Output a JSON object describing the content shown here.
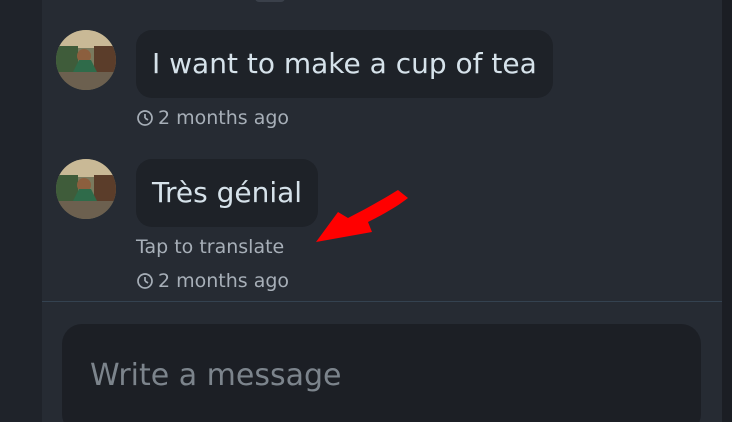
{
  "messages": [
    {
      "text": "I want to make a cup of tea",
      "timestamp": "2 months ago",
      "translate_label": ""
    },
    {
      "text": "Très génial",
      "timestamp": "2 months ago",
      "translate_label": "Tap to translate"
    }
  ],
  "composer": {
    "placeholder": "Write a message"
  },
  "icons": {
    "timestamp_icon": "clock-icon",
    "annotation": "red-arrow-icon"
  },
  "colors": {
    "background": "#1f232a",
    "panel": "#262b33",
    "bubble": "#1e2228",
    "text": "#d6e2ea",
    "muted": "#a7afb8",
    "arrow": "#ff0000"
  }
}
